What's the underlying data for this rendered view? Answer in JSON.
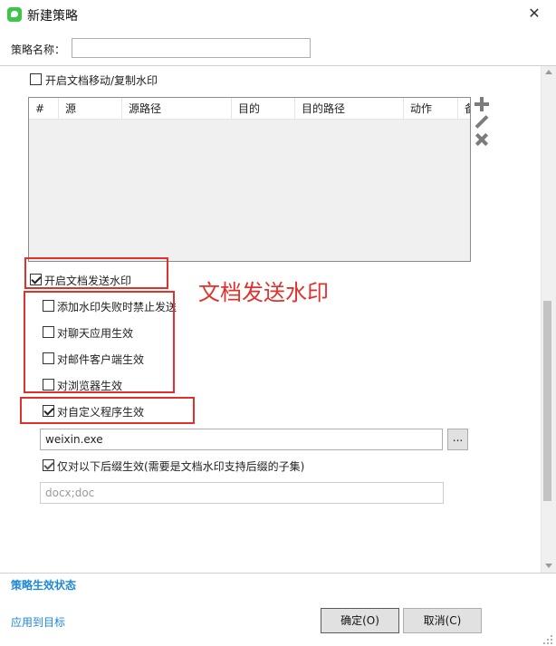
{
  "window": {
    "title": "新建策略",
    "close_glyph": "✕",
    "app_icon": "wechat-icon",
    "app_icon_color": "#3cc54a"
  },
  "policy_name": {
    "label": "策略名称：",
    "value": ""
  },
  "doc_move_copy_watermark": {
    "label": "开启文档移动/复制水印",
    "checked": false
  },
  "rules_table": {
    "columns": [
      "#",
      "源",
      "源路径",
      "目的",
      "目的路径",
      "动作",
      "备"
    ],
    "rows": []
  },
  "table_tools": [
    {
      "name": "add",
      "icon": "plus-icon"
    },
    {
      "name": "edit",
      "icon": "pencil-icon"
    },
    {
      "name": "delete",
      "icon": "x-icon"
    }
  ],
  "doc_send_watermark": {
    "label": "开启文档发送水印",
    "checked": true
  },
  "send_options": [
    {
      "label": "添加水印失败时禁止发送",
      "checked": false
    },
    {
      "label": "对聊天应用生效",
      "checked": false
    },
    {
      "label": "对邮件客户端生效",
      "checked": false
    },
    {
      "label": "对浏览器生效",
      "checked": false
    },
    {
      "label": "对自定义程序生效",
      "checked": true
    }
  ],
  "custom_program": {
    "value": "weixin.exe",
    "browse_label": "..."
  },
  "suffix_only": {
    "label": "仅对以下后缀生效(需要是文档水印支持后缀的子集)",
    "checked": true,
    "value": "docx;doc"
  },
  "annotation": {
    "text": "文档发送水印",
    "color": "#e0312d"
  },
  "footer": {
    "status_link": "策略生效状态",
    "apply_link": "应用到目标",
    "ok_label": "确定(O)",
    "cancel_label": "取消(C)",
    "link_color": "#1e88d8"
  }
}
